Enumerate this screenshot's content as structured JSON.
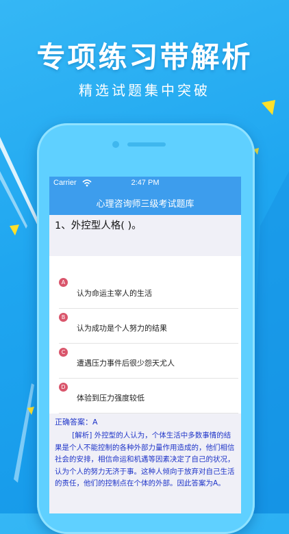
{
  "promo": {
    "headline": "专项练习带解析",
    "subline": "精选试题集中突破"
  },
  "status_bar": {
    "carrier": "Carrier",
    "time": "2:47 PM"
  },
  "nav": {
    "title": "心理咨询师三级考试题库"
  },
  "question": {
    "text": "1、外控型人格(     )。"
  },
  "options": [
    {
      "letter": "A",
      "text": "认为命运主宰人的生活"
    },
    {
      "letter": "B",
      "text": "认为成功是个人努力的结果"
    },
    {
      "letter": "C",
      "text": "遭遇压力事件后很少怨天尤人"
    },
    {
      "letter": "D",
      "text": "体验到压力强度较低"
    }
  ],
  "answer": {
    "label": "正确答案：A",
    "analysis": "[解析] 外控型的人认为，个体生活中多数事情的结果是个人不能控制的各种外部力量作用造成的，他们相信社会的安排，相信命运和机遇等因素决定了自己的状况，认为个人的努力无济于事。这种人倾向于放弃对自己生活的责任，他们的控制点在个体的外部。因此答案为A。"
  },
  "colors": {
    "background": "#1fa6f0",
    "nav": "#3d9ded",
    "badge": "#d9556b",
    "answer_text": "#1f35c8",
    "accent_yellow": "#ffe02a"
  }
}
